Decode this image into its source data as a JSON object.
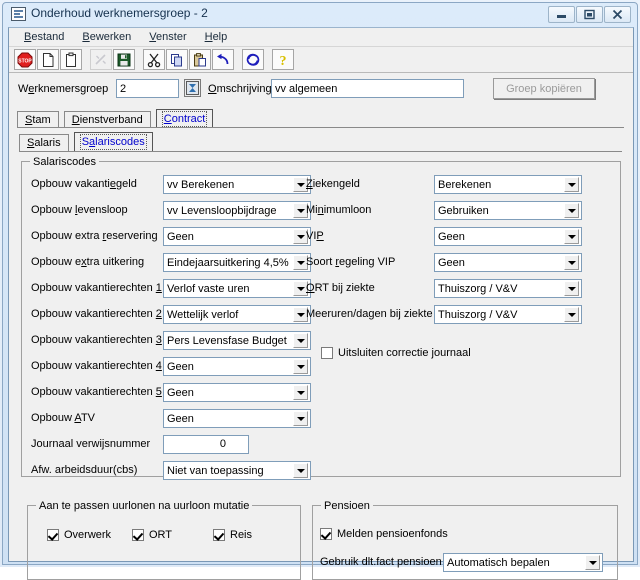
{
  "window": {
    "title": "Onderhoud werknemersgroep - 2",
    "icon": "window-list-icon",
    "minimize_label": "—",
    "restore_label": "□",
    "close_label": "✕"
  },
  "menubar": {
    "items": [
      {
        "label": "Bestand",
        "accel": "B"
      },
      {
        "label": "Bewerken",
        "accel": "B"
      },
      {
        "label": "Venster",
        "accel": "V"
      },
      {
        "label": "Help",
        "accel": "H"
      }
    ]
  },
  "toolbar": {
    "buttons": [
      {
        "name": "stop-button",
        "icon": "stop-icon",
        "enabled": true
      },
      {
        "name": "new-button",
        "icon": "new-document-icon",
        "enabled": true
      },
      {
        "name": "open-button",
        "icon": "clipboard-icon",
        "enabled": true
      },
      {
        "name": "cut-link-button",
        "icon": "break-link-icon",
        "enabled": false
      },
      {
        "name": "save-button",
        "icon": "floppy-save-icon",
        "enabled": true
      },
      {
        "name": "cut-button",
        "icon": "scissors-icon",
        "enabled": true
      },
      {
        "name": "copy-button",
        "icon": "copy-icon",
        "enabled": true
      },
      {
        "name": "paste-button",
        "icon": "paste-icon",
        "enabled": true
      },
      {
        "name": "undo-button",
        "icon": "undo-arrow-icon",
        "enabled": true
      },
      {
        "name": "refresh-button",
        "icon": "refresh-icon",
        "enabled": true
      },
      {
        "name": "help-button",
        "icon": "question-mark-icon",
        "enabled": true
      }
    ]
  },
  "header": {
    "group_label": "Werknemersgroep",
    "group_value": "2",
    "lookup_icon": "lookup-icon",
    "description_label": "Omschrijving",
    "description_value": "vv algemeen",
    "copy_button_label": "Groep kopiëren",
    "copy_button_enabled": false
  },
  "tabs_primary": [
    {
      "label": "Stam",
      "active": false
    },
    {
      "label": "Dienstverband",
      "active": false
    },
    {
      "label": "Contract",
      "active": true
    }
  ],
  "tabs_secondary": [
    {
      "label": "Salaris",
      "active": false
    },
    {
      "label": "Salariscodes",
      "active": true
    }
  ],
  "salariscodes": {
    "title": "Salariscodes",
    "left_fields": [
      {
        "label": "Opbouw vakantiegeld",
        "value": "vv Berekenen",
        "type": "combo"
      },
      {
        "label": "Opbouw levensloop",
        "value": "vv Levensloopbijdrage",
        "type": "combo"
      },
      {
        "label": "Opbouw extra reservering",
        "value": "Geen",
        "type": "combo"
      },
      {
        "label": "Opbouw extra uitkering",
        "value": "Eindejaarsuitkering 4,5%",
        "type": "combo"
      },
      {
        "label": "Opbouw vakantierechten 1",
        "value": "Verlof vaste uren",
        "type": "combo"
      },
      {
        "label": "Opbouw vakantierechten 2",
        "value": "Wettelijk verlof",
        "type": "combo"
      },
      {
        "label": "Opbouw vakantierechten 3",
        "value": "Pers Levensfase Budget",
        "type": "combo"
      },
      {
        "label": "Opbouw vakantierechten 4",
        "value": "Geen",
        "type": "combo"
      },
      {
        "label": "Opbouw vakantierechten 5",
        "value": "Geen",
        "type": "combo"
      },
      {
        "label": "Opbouw ATV",
        "value": "Geen",
        "type": "combo"
      },
      {
        "label": "Journaal verwijsnummer",
        "value": "0",
        "type": "number"
      },
      {
        "label": "Afw. arbeidsduur(cbs)",
        "value": "Niet van toepassing",
        "type": "combo"
      }
    ],
    "right_fields": [
      {
        "label": "Ziekengeld",
        "value": "Berekenen",
        "type": "combo"
      },
      {
        "label": "Minimumloon",
        "value": "Gebruiken",
        "type": "combo"
      },
      {
        "label": "VIP",
        "value": "Geen",
        "type": "combo"
      },
      {
        "label": "Soort regeling VIP",
        "value": "Geen",
        "type": "combo"
      },
      {
        "label": "ORT bij ziekte",
        "value": "Thuiszorg / V&V",
        "type": "combo"
      },
      {
        "label": "Meeruren/dagen bij ziekte",
        "value": "Thuiszorg / V&V",
        "type": "combo"
      }
    ],
    "exclude_checkbox": {
      "label": "Uitsluiten correctie journaal",
      "checked": false
    }
  },
  "uurlonen": {
    "title": "Aan te passen uurlonen na uurloon mutatie",
    "checkboxes": [
      {
        "label": "Overwerk",
        "checked": true
      },
      {
        "label": "ORT",
        "checked": true
      },
      {
        "label": "Reis",
        "checked": true
      }
    ]
  },
  "pensioen": {
    "title": "Pensioen",
    "checkbox": {
      "label": "Melden pensioenfonds",
      "checked": true
    },
    "field_label": "Gebruik dlt.fact pensioen",
    "field_value": "Automatisch bepalen"
  },
  "colors": {
    "dialog_face": "#f0f0f0",
    "field_border": "#7f9db9",
    "active_tab_text": "#0000cc",
    "title_text": "#16324f",
    "stop_red": "#e02020",
    "accent_blue": "#1d1dbb"
  }
}
